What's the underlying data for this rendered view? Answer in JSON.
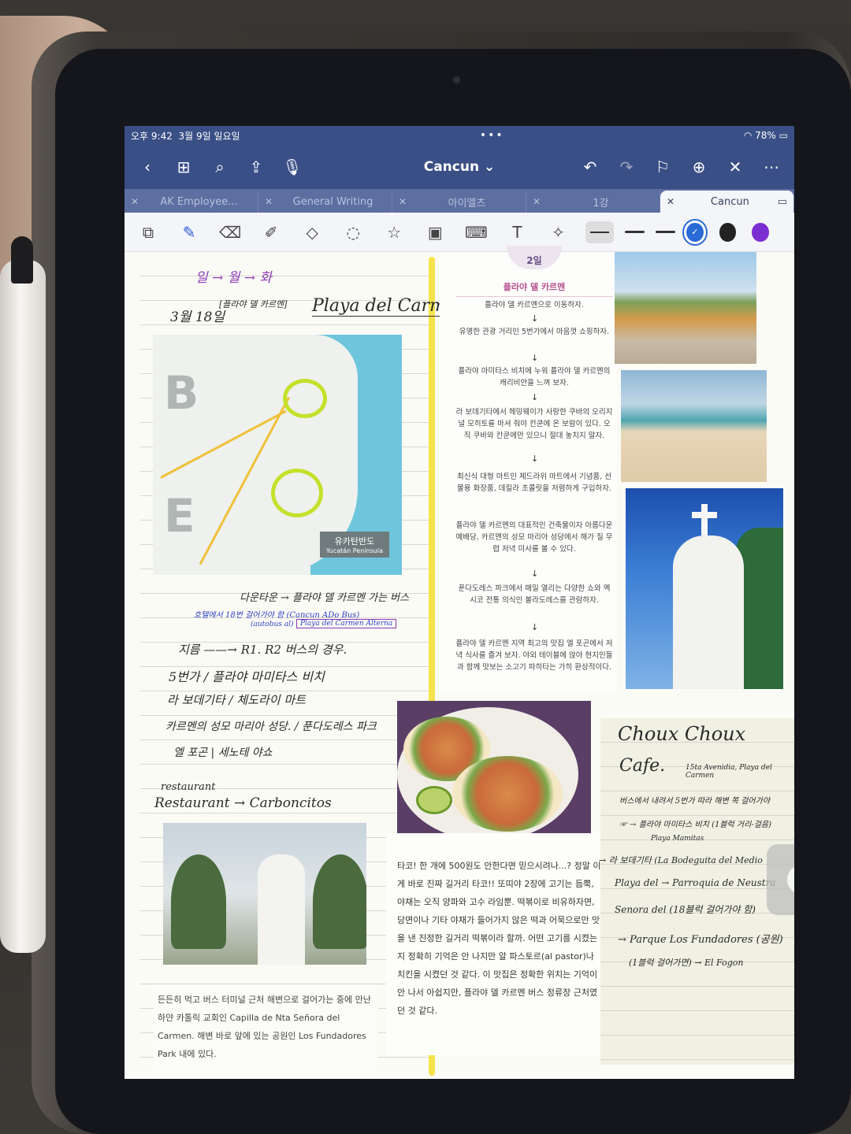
{
  "status": {
    "time": "오후 9:42",
    "date": "3월 9일 일요일",
    "battery": "78%"
  },
  "nav": {
    "title": "Cancun",
    "icons": [
      "back-icon",
      "grid-icon",
      "search-icon",
      "share-icon",
      "microphone-icon",
      "undo-icon",
      "redo-icon",
      "bookmark-icon",
      "add-page-icon",
      "close-icon",
      "more-icon"
    ]
  },
  "tabs": [
    {
      "label": "AK Employee..."
    },
    {
      "label": "General Writing"
    },
    {
      "label": "아이엘츠"
    },
    {
      "label": "1강"
    },
    {
      "label": "Cancun"
    }
  ],
  "colors": {
    "accent": "#3a4f86",
    "pen_blue": "#2a6ad6",
    "pen_black": "#222222",
    "pen_purple": "#7b2fd0",
    "highlight": "#f4e34b"
  },
  "left": {
    "hw_top": "일 → 월 → 화",
    "hw_date": "3월 18일",
    "hw_place_kr": "[플라야 델 카르멘]",
    "hw_place": "Playa del Carmen",
    "map_big_b": "B",
    "map_big_e": "E",
    "map_label_kr": "유카탄반도",
    "map_label_en": "Yucatán Peninsula",
    "hw_bus": "다운타운 → 플라야 델 카르멘 가는 버스",
    "hw_bus2": "호텔에서 18번 걸어가야 함 (Cancun ADo Bus)",
    "hw_bus3": "(autobus al)",
    "hw_bus_box": "Playa del Carmen Alterna",
    "hw_l1": "지름 ——→ R1. R2 버스의 경우.",
    "hw_l2": "5번가 / 플라야 마미타스 비치",
    "hw_l3": "라 보데기타 / 체도라이 마트",
    "hw_l4": "카르멘의 성모 마리아 성당. / 푼다도레스 파크",
    "hw_l5": "엘 포곤   |  세노테 야쇼",
    "hw_rest1": "restaurant",
    "hw_rest2": "Restaurant → Carboncitos",
    "church_caption": "든든히 먹고 버스 터미널 근처 해변으로 걸어가는 중에 만난 하얀 카톨릭 교회인 Capilla de Nta Señora del Carmen. 해변 바로 앞에 있는 공원인 Los Fundadores Park 내에 있다."
  },
  "mid": {
    "date": "2일",
    "title": "플라야 델 카르멘",
    "steps": [
      "플라야 델 카르멘으로 이동하자.",
      "유명한 관광 거리인 5번가에서 마음껏 쇼핑하자.",
      "플라야 마미타스 비치에 누워 플라야 델 카르멘의 캐리비안을 느껴 보자.",
      "라 보데기타에서 헤밍웨이가 사랑한 쿠바의 오리지널 모히토를 마셔 줘야 칸쿤에 온 보람이 있다. 오직 쿠바와 칸쿤에만 있으니 절대 놓치지 말자.",
      "최신식 대형 마트인 체드라위 마트에서 기념품, 선물용 화장품, 데킬라 초콜릿을 저렴하게 구입하자.",
      "플라야 델 카르멘의 대표적인 건축물이자 아름다운 예배당, 카르멘의 성모 마리아 성당에서 해가 질 무렵 저녁 미사를 볼 수 있다.",
      "푼다도레스 파크에서 매일 열리는 다양한 쇼와 멕시코 전통 의식인 볼라도레스를 관람하자.",
      "플라야 델 카르멘 지역 최고의 맛집 엘 포곤에서 저녁 식사를 즐겨 보자. 야외 테이블에 앉아 현지인들과 함께 맛보는 소고기 파히타는 가히 환상적이다."
    ],
    "arrow": "↓",
    "taco_caption": "타코! 한 개에 500원도 안한다면 믿으시려나...? 정말 이게 바로 진짜 길거리 타코!! 또띠야 2장에 고기는 듬뿍, 야채는 오직 양파와 고수 라임뿐. 떡볶이로 비유하자면, 당면이나 기타 야채가 들어가지 않은 떡과 어묵으로만 맛을 낸 진정한 길거리 떡볶이라 할까. 어떤 고기를 시켰는지 정확히 기억은 안 나지만 알 파스토르(al pastor)나 치킨을 시켰던 것 같다. 이 맛집은 정확한 위치는 기억이 안 나서 아쉽지만, 플라야 델 카르멘 버스 정류장 근처였던 것 같다."
  },
  "right": {
    "hw_title1": "Choux Choux",
    "hw_title2": "Cafe.",
    "hw_addr": "15ta Avenidia, Playa del Carmen",
    "hw_n1": "버스에서 내려서 5번가 따라 해변 쪽 걸어가야",
    "hw_n2": "☞ → 플라야 마미타스 비치 (1블럭 거리-걸음)",
    "hw_n3": "Playa Mamitas",
    "hw_n4": "→ 라 보데기타 (La Bodeguita del Medio",
    "hw_n5": "Playa del → Parroquia de Neustra",
    "hw_n6": "Senora del (18블럭 걸어가야 함)",
    "hw_n7": "→ Parque Los Fundadores (공원)",
    "hw_n8": "(1블럭 걸어가면) → El Fogon"
  }
}
